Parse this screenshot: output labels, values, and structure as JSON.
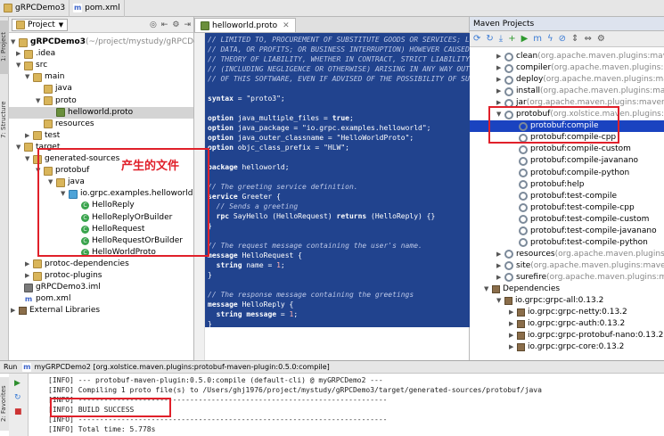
{
  "breadcrumb": [
    "gRPCDemo3",
    "pom.xml"
  ],
  "project_panel": {
    "selector": "Project",
    "tree": [
      {
        "label": "gRPCDemo3",
        "extra": "(~/project/mystudy/gRPCDemo3"
      },
      {
        "label": ".idea"
      },
      {
        "label": "src"
      },
      {
        "label": "main"
      },
      {
        "label": "java"
      },
      {
        "label": "proto"
      },
      {
        "label": "helloworld.proto"
      },
      {
        "label": "resources"
      },
      {
        "label": "test"
      },
      {
        "label": "target"
      },
      {
        "label": "generated-sources"
      },
      {
        "label": "protobuf"
      },
      {
        "label": "java"
      },
      {
        "label": "io.grpc.examples.helloworld"
      },
      {
        "label": "HelloReply"
      },
      {
        "label": "HelloReplyOrBuilder"
      },
      {
        "label": "HelloRequest"
      },
      {
        "label": "HelloRequestOrBuilder"
      },
      {
        "label": "HelloWorldProto"
      },
      {
        "label": "protoc-dependencies"
      },
      {
        "label": "protoc-plugins"
      },
      {
        "label": "gRPCDemo3.iml"
      },
      {
        "label": "pom.xml"
      },
      {
        "label": "External Libraries"
      }
    ],
    "annotation": "产生的文件"
  },
  "editor": {
    "tab": "helloworld.proto",
    "lines": [
      "// LIMITED TO, PROCUREMENT OF SUBSTITUTE GOODS OR SERVICES; LOS",
      "// DATA, OR PROFITS; OR BUSINESS INTERRUPTION) HOWEVER CAUSED",
      "// THEORY OF LIABILITY, WHETHER IN CONTRACT, STRICT LIABILITY,",
      "// (INCLUDING NEGLIGENCE OR OTHERWISE) ARISING IN ANY WAY OUT",
      "// OF THIS SOFTWARE, EVEN IF ADVISED OF THE POSSIBILITY OF SUC",
      "",
      "syntax = \"proto3\";",
      "",
      "option java_multiple_files = true;",
      "option java_package = \"io.grpc.examples.helloworld\";",
      "option java_outer_classname = \"HelloWorldProto\";",
      "option objc_class_prefix = \"HLW\";",
      "",
      "package helloworld;",
      "",
      "// The greeting service definition.",
      "service Greeter {",
      "  // Sends a greeting",
      "  rpc SayHello (HelloRequest) returns (HelloReply) {}",
      "}",
      "",
      "// The request message containing the user's name.",
      "message HelloRequest {",
      "  string name = 1;",
      "}",
      "",
      "// The response message containing the greetings",
      "message HelloReply {",
      "  string message = 1;",
      "}"
    ]
  },
  "maven_panel": {
    "title": "Maven Projects",
    "items": [
      {
        "label": "clean",
        "extra": "(org.apache.maven.plugins:maven-"
      },
      {
        "label": "compiler",
        "extra": "(org.apache.maven.plugins:mav"
      },
      {
        "label": "deploy",
        "extra": "(org.apache.maven.plugins:maven"
      },
      {
        "label": "install",
        "extra": "(org.apache.maven.plugins:mave"
      },
      {
        "label": "jar",
        "extra": "(org.apache.maven.plugins:maven-ja"
      },
      {
        "label": "protobuf",
        "extra": "(org.xolstice.maven.plugins:pro"
      },
      {
        "label": "protobuf:compile",
        "extra": ""
      },
      {
        "label": "protobuf:compile-cpp",
        "extra": ""
      },
      {
        "label": "protobuf:compile-custom",
        "extra": ""
      },
      {
        "label": "protobuf:compile-javanano",
        "extra": ""
      },
      {
        "label": "protobuf:compile-python",
        "extra": ""
      },
      {
        "label": "protobuf:help",
        "extra": ""
      },
      {
        "label": "protobuf:test-compile",
        "extra": ""
      },
      {
        "label": "protobuf:test-compile-cpp",
        "extra": ""
      },
      {
        "label": "protobuf:test-compile-custom",
        "extra": ""
      },
      {
        "label": "protobuf:test-compile-javanano",
        "extra": ""
      },
      {
        "label": "protobuf:test-compile-python",
        "extra": ""
      },
      {
        "label": "resources",
        "extra": "(org.apache.maven.plugins:ma"
      },
      {
        "label": "site",
        "extra": "(org.apache.maven.plugins:maven-s"
      },
      {
        "label": "surefire",
        "extra": "(org.apache.maven.plugins:mav"
      },
      {
        "label": "Dependencies",
        "extra": ""
      },
      {
        "label": "io.grpc:grpc-all:0.13.2",
        "extra": ""
      },
      {
        "label": "io.grpc:grpc-netty:0.13.2",
        "extra": ""
      },
      {
        "label": "io.grpc:grpc-auth:0.13.2",
        "extra": ""
      },
      {
        "label": "io.grpc:grpc-protobuf-nano:0.13.2",
        "extra": ""
      },
      {
        "label": "io.grpc:grpc-core:0.13.2",
        "extra": ""
      }
    ]
  },
  "run_panel": {
    "title": "Run",
    "config": "myGRPCDemo2 [org.xolstice.maven.plugins:protobuf-maven-plugin:0.5.0:compile]",
    "lines": [
      "[INFO] --- protobuf-maven-plugin:0.5.0:compile (default-cli) @ myGRPCDemo2 ---",
      "[INFO] Compiling 1 proto file(s) to /Users/ghj1976/project/mystudy/gRPCDemo3/target/generated-sources/protobuf/java",
      "[INFO] ------------------------------------------------------------------------",
      "[INFO] BUILD SUCCESS",
      "[INFO] ------------------------------------------------------------------------",
      "[INFO] Total time: 5.778s"
    ]
  },
  "side_tabs": [
    "1: Project",
    "7: Structure",
    "2: Favorites"
  ],
  "colors": {
    "highlight_red": "#e0202a",
    "selection_blue": "#1a43c0",
    "editor_selection": "#21438e"
  }
}
